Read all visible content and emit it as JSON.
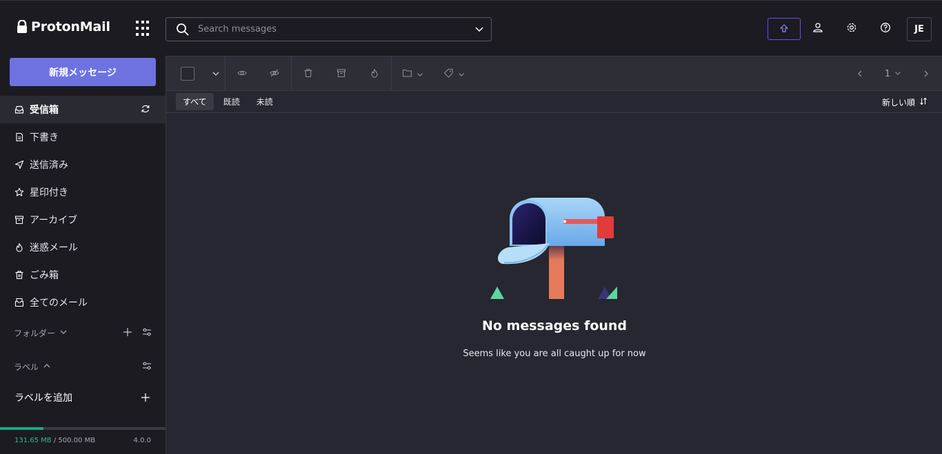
{
  "app": {
    "brand": "ProtonMail"
  },
  "search": {
    "placeholder": "Search messages"
  },
  "user": {
    "initials": "JE"
  },
  "sidebar": {
    "compose_label": "新規メッセージ",
    "items": [
      {
        "label": "受信箱",
        "icon": "inbox-icon",
        "active": true
      },
      {
        "label": "下書き",
        "icon": "draft-icon"
      },
      {
        "label": "送信済み",
        "icon": "sent-icon"
      },
      {
        "label": "星印付き",
        "icon": "star-icon"
      },
      {
        "label": "アーカイブ",
        "icon": "archive-icon"
      },
      {
        "label": "迷惑メール",
        "icon": "spam-icon"
      },
      {
        "label": "ごみ箱",
        "icon": "trash-icon"
      },
      {
        "label": "全てのメール",
        "icon": "all-mail-icon"
      }
    ],
    "folders_label": "フォルダー",
    "labels_label": "ラベル",
    "add_label": "ラベルを追加",
    "storage": {
      "used": "131.65 MB",
      "separator": " / ",
      "total": "500.00 MB",
      "fraction": 0.263
    },
    "version": "4.0.0"
  },
  "toolbar": {
    "page": "1"
  },
  "filters": {
    "tabs": [
      "すべて",
      "既読",
      "未読"
    ],
    "active": "すべて",
    "sort_label": "新しい順"
  },
  "empty": {
    "title": "No messages found",
    "subtitle": "Seems like you are all caught up for now"
  },
  "colors": {
    "accent": "#6d4aff",
    "compose": "#6d72e0",
    "storage_fill": "#1ea885"
  }
}
